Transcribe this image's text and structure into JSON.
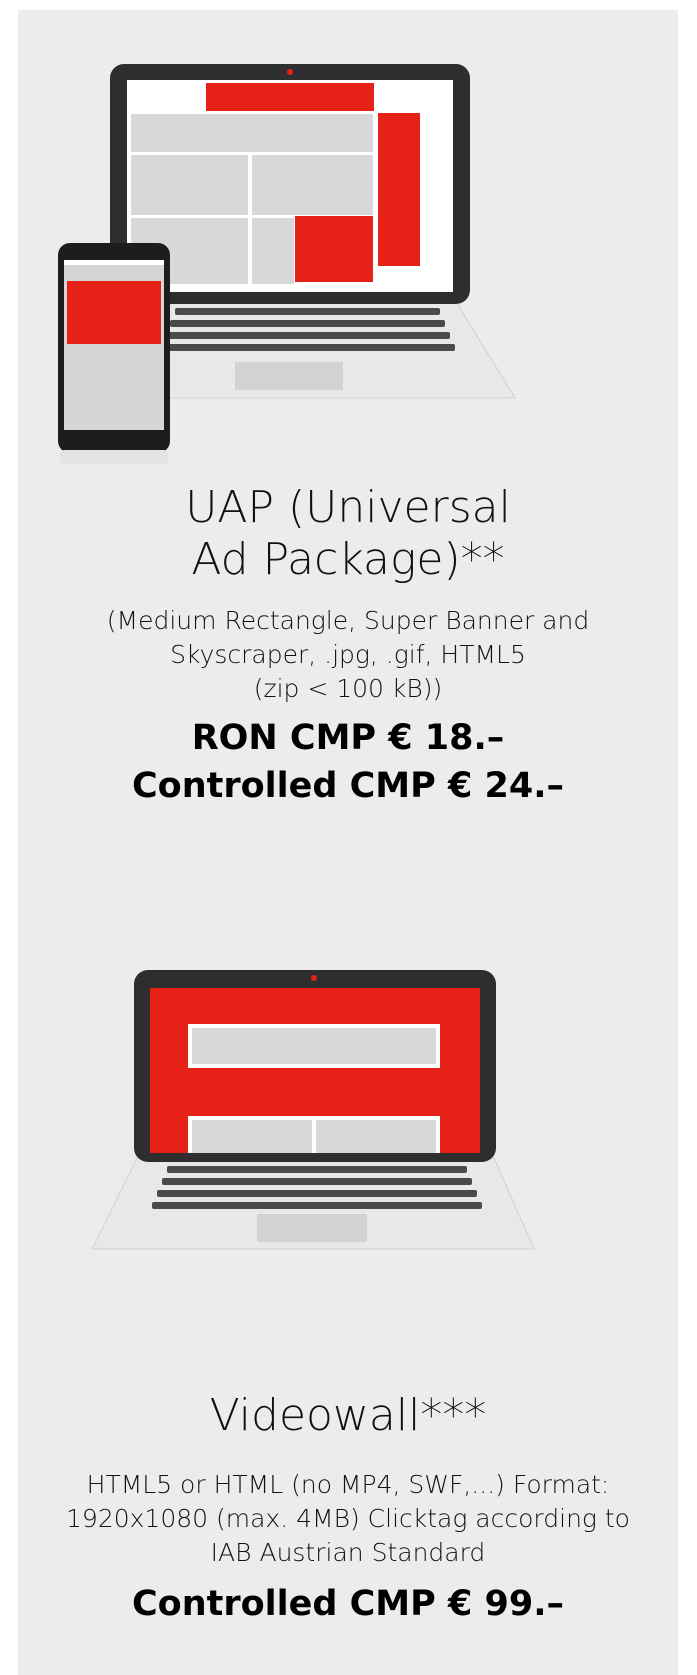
{
  "products": [
    {
      "title_line1": "UAP (Universal",
      "title_line2": "Ad Package)**",
      "desc_line1": "(Medium Rectangle, Super Banner and",
      "desc_line2": "Skyscraper, .jpg, .gif, HTML5",
      "desc_line3": "(zip < 100 kB))",
      "price1": "RON CMP € 18.–",
      "price2": "Controlled CMP € 24.–",
      "illustration": "laptop-and-phone-ad-placements"
    },
    {
      "title_line1": "Videowall***",
      "desc_line1": "HTML5 or HTML (no MP4, SWF,...) Format:",
      "desc_line2": "1920x1080 (max. 4MB) Clicktag according to",
      "desc_line3": "IAB Austrian Standard",
      "price1": "Controlled CMP € 99.–",
      "illustration": "laptop-videowall-ad"
    }
  ],
  "colors": {
    "panel": "#ececec",
    "accent_red": "#e62218",
    "device_dark": "#2e2e2e",
    "placeholder_gray": "#d6d6d6"
  }
}
